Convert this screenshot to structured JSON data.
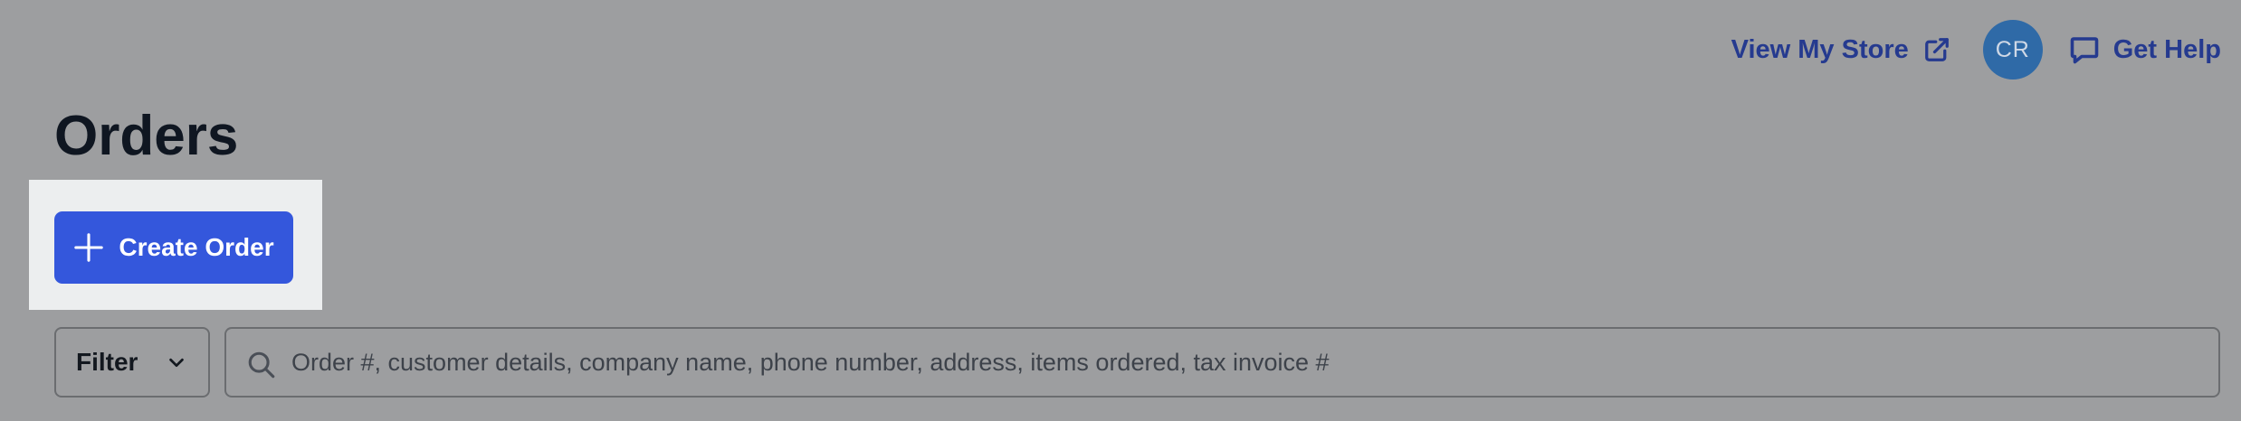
{
  "header": {
    "view_store_label": "View My Store",
    "avatar_initials": "CR",
    "help_label": "Get Help"
  },
  "page": {
    "title": "Orders"
  },
  "actions": {
    "create_order_label": "Create Order"
  },
  "filter": {
    "label": "Filter"
  },
  "search": {
    "placeholder": "Order #, customer details, company name, phone number, address, items ordered, tax invoice #",
    "value": ""
  },
  "icons": {
    "external": "external-link-icon",
    "chat": "chat-bubble-icon",
    "plus": "plus-icon",
    "chevron": "chevron-down-icon",
    "search": "search-icon"
  },
  "colors": {
    "link": "#253a8f",
    "avatar": "#2f6aa7",
    "primary": "#3457dc",
    "title": "#0f1621"
  }
}
